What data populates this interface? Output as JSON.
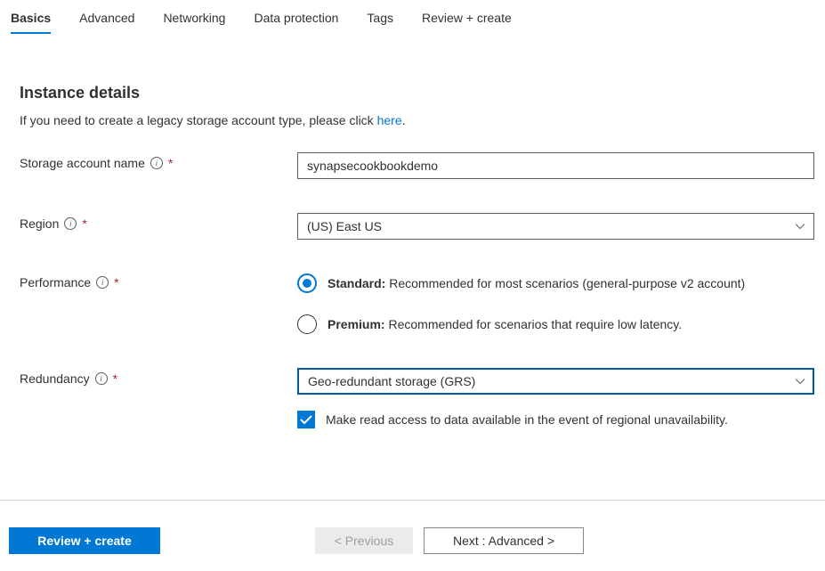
{
  "tabs": [
    {
      "label": "Basics",
      "active": true
    },
    {
      "label": "Advanced",
      "active": false
    },
    {
      "label": "Networking",
      "active": false
    },
    {
      "label": "Data protection",
      "active": false
    },
    {
      "label": "Tags",
      "active": false
    },
    {
      "label": "Review + create",
      "active": false
    }
  ],
  "section": {
    "heading": "Instance details",
    "subtext_prefix": "If you need to create a legacy storage account type, please click ",
    "subtext_link": "here",
    "subtext_suffix": "."
  },
  "fields": {
    "storage_account_name": {
      "label": "Storage account name",
      "value": "synapsecookbookdemo",
      "required": true
    },
    "region": {
      "label": "Region",
      "value": "(US) East US",
      "required": true
    },
    "performance": {
      "label": "Performance",
      "required": true,
      "options": [
        {
          "title": "Standard:",
          "desc": " Recommended for most scenarios (general-purpose v2 account)",
          "selected": true
        },
        {
          "title": "Premium:",
          "desc": " Recommended for scenarios that require low latency.",
          "selected": false
        }
      ]
    },
    "redundancy": {
      "label": "Redundancy",
      "value": "Geo-redundant storage (GRS)",
      "required": true,
      "checkbox_label": "Make read access to data available in the event of regional unavailability.",
      "checkbox_checked": true
    }
  },
  "footer": {
    "review_create": "Review + create",
    "previous": "< Previous",
    "next": "Next : Advanced >"
  },
  "required_mark": "*"
}
